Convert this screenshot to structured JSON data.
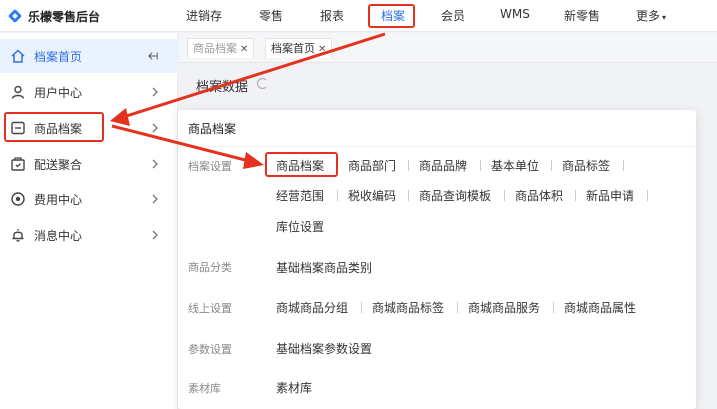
{
  "app": {
    "logo_text": "乐檬零售后台"
  },
  "topnav": {
    "items": [
      {
        "label": "进销存",
        "active": false
      },
      {
        "label": "零售",
        "active": false
      },
      {
        "label": "报表",
        "active": false
      },
      {
        "label": "档案",
        "active": true
      },
      {
        "label": "会员",
        "active": false
      },
      {
        "label": "WMS",
        "active": false
      },
      {
        "label": "新零售",
        "active": false
      },
      {
        "label": "更多",
        "active": false
      }
    ]
  },
  "sidebar": {
    "collapse_icon": "collapse-icon",
    "items": [
      {
        "label": "档案首页",
        "icon": "home-icon",
        "active": true
      },
      {
        "label": "用户中心",
        "icon": "user-icon",
        "active": false
      },
      {
        "label": "商品档案",
        "icon": "product-icon",
        "active": false
      },
      {
        "label": "配送聚合",
        "icon": "delivery-icon",
        "active": false
      },
      {
        "label": "费用中心",
        "icon": "cost-icon",
        "active": false
      },
      {
        "label": "消息中心",
        "icon": "bell-icon",
        "active": false
      }
    ]
  },
  "tabs": [
    {
      "label": "商品档案",
      "closable": true
    },
    {
      "label": "档案首页",
      "closable": true
    }
  ],
  "page": {
    "title": "档案数据"
  },
  "panel": {
    "header": "商品档案",
    "groups": [
      {
        "label": "档案设置",
        "rows": [
          [
            "商品档案",
            "商品部门",
            "商品品牌",
            "基本单位",
            "商品标签"
          ],
          [
            "经营范围",
            "税收编码",
            "商品查询模板",
            "商品体积",
            "新品申请"
          ],
          [
            "库位设置"
          ]
        ]
      },
      {
        "label": "商品分类",
        "rows": [
          [
            "基础档案商品类别"
          ]
        ]
      },
      {
        "label": "线上设置",
        "rows": [
          [
            "商城商品分组",
            "商城商品标签",
            "商城商品服务",
            "商城商品属性"
          ]
        ]
      },
      {
        "label": "参数设置",
        "rows": [
          [
            "基础档案参数设置"
          ]
        ]
      },
      {
        "label": "素材库",
        "rows": [
          [
            "素材库"
          ]
        ]
      }
    ]
  },
  "colors": {
    "accent": "#2f6fe4",
    "highlight": "#e5321f"
  }
}
